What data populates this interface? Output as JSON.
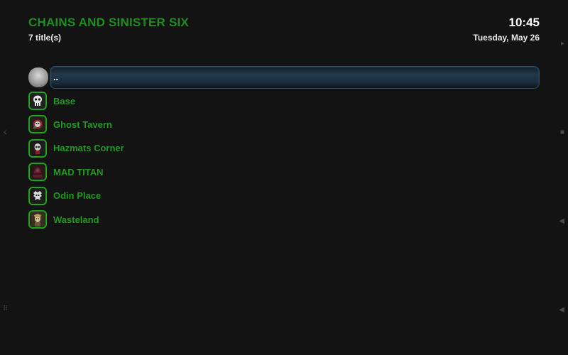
{
  "header": {
    "title": "CHAINS AND SINISTER SIX",
    "subtitle": "7 title(s)",
    "time": "10:45",
    "date": "Tuesday, May 26"
  },
  "list": {
    "items": [
      {
        "label": "..",
        "icon": "parent-folder-icon",
        "selected": true
      },
      {
        "label": "Base",
        "icon": "skull-icon"
      },
      {
        "label": "Ghost Tavern",
        "icon": "ghost-tavern-icon"
      },
      {
        "label": "Hazmats Corner",
        "icon": "hazmat-icon"
      },
      {
        "label": "MAD TITAN",
        "icon": "titan-icon"
      },
      {
        "label": "Odin Place",
        "icon": "odin-icon"
      },
      {
        "label": "Wasteland",
        "icon": "wasteland-icon"
      }
    ]
  },
  "edges": {
    "left_arrow": "‹",
    "right_arrow": "▸",
    "stop": "■",
    "volume": "◀",
    "grid": "⠿"
  },
  "colors": {
    "background": "#131313",
    "accent_green": "#1e9a1e",
    "selection": "#22384a"
  }
}
